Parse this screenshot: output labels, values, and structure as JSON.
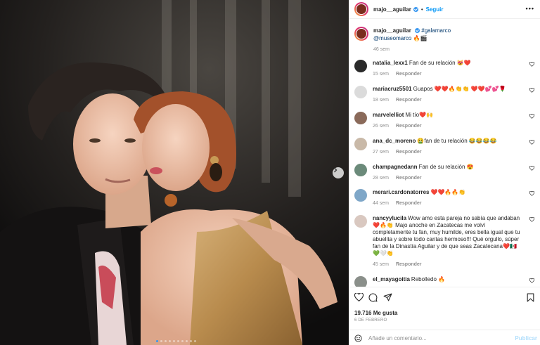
{
  "post": {
    "image_alt": "",
    "carousel": {
      "dot_count": 10,
      "active_index": 0
    }
  },
  "header": {
    "username": "majo__aguilar",
    "separator": "•",
    "follow_label": "Seguir",
    "more_label": "•••"
  },
  "caption": {
    "username": "majo__aguilar",
    "hashtag": "#galamarco",
    "mention": "@museomarco",
    "emoji": "🔥🎬",
    "time": "46 sem"
  },
  "comments": [
    {
      "user": "natalia_lexx1",
      "text": "Fan de su relación 😻❤️",
      "time": "15 sem",
      "reply": "Responder",
      "avatar_color": "#2a2a2a"
    },
    {
      "user": "mariacruz5501",
      "text": "Guapos ❤️❤️🔥👏👏 ❤️❤️💕💕🌹",
      "time": "18 sem",
      "reply": "Responder",
      "avatar_color": "#dbdbdb"
    },
    {
      "user": "marvelelliot",
      "text": "Mi tío❤️🙌",
      "time": "26 sem",
      "reply": "Responder",
      "avatar_color": "#8a6a5a"
    },
    {
      "user": "ana_dc_moreno",
      "text": "🤮fan de tu relación 😂😂😂😂",
      "time": "27 sem",
      "reply": "Responder",
      "avatar_color": "#c9b9a8"
    },
    {
      "user": "champagnedann",
      "text": "Fan de su relación 😍",
      "time": "28 sem",
      "reply": "Responder",
      "avatar_color": "#6b8a7a"
    },
    {
      "user": "merari.cardonatorres",
      "text": "❤️❤️🔥🔥👏",
      "time": "44 sem",
      "reply": "Responder",
      "avatar_color": "#7fa7c8"
    },
    {
      "user": "nancyylucila",
      "text": "Wow amo esta pareja no sabía que andaban ❤️🔥👏 Majo anoche en Zacatecas me volví completamente tu fan, muy humilde, eres bella igual que tu abuelita y sobre todo cantas hermoso!!! Qué orgullo, súper fan de la Dinastía Aguilar y de que seas Zacatecana❤️🇲🇽💚🤍👏",
      "time": "45 sem",
      "reply": "Responder",
      "avatar_color": "#d9c8c0"
    },
    {
      "user": "el_mayagoitia",
      "text": "Rebolledo 🔥",
      "time": "",
      "reply": "",
      "avatar_color": "#8a8f8a"
    }
  ],
  "actions": {
    "likes": "19.716 Me gusta",
    "date": "6 DE FEBRERO"
  },
  "composer": {
    "placeholder": "Añade un comentario...",
    "publish_label": "Publicar"
  },
  "colors": {
    "accent": "#0095f6",
    "verified": "#3897f0",
    "muted": "#8e8e8e"
  }
}
